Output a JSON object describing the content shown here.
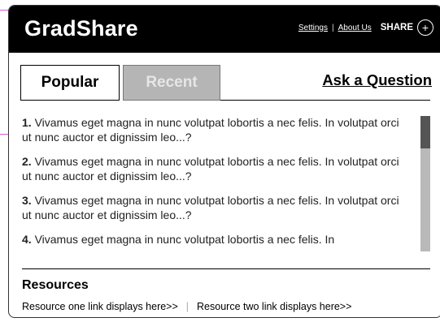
{
  "header": {
    "logo": "GradShare",
    "settings_link": "Settings",
    "link_separator": "|",
    "about_link": "About Us",
    "share_label": "SHARE",
    "share_button": "+"
  },
  "tabs": [
    {
      "label": "Popular",
      "active": true
    },
    {
      "label": "Recent",
      "active": false
    }
  ],
  "ask_link": "Ask a Question",
  "questions": [
    {
      "number": "1.",
      "text": "Vivamus eget magna in nunc volutpat lobortis a nec felis. In volutpat orci ut nunc auctor et dignissim leo...?"
    },
    {
      "number": "2.",
      "text": "Vivamus eget magna in nunc volutpat lobortis a nec felis. In volutpat orci ut nunc auctor et dignissim leo...?"
    },
    {
      "number": "3.",
      "text": "Vivamus eget magna in nunc volutpat lobortis a nec felis. In volutpat orci ut nunc auctor et dignissim leo...?"
    },
    {
      "number": "4.",
      "text": "Vivamus eget magna in nunc volutpat lobortis a nec felis. In"
    }
  ],
  "resources": {
    "heading": "Resources",
    "link_one": "Resource one link displays here>>",
    "separator": "|",
    "link_two": "Resource two link displays here>>"
  },
  "colors": {
    "header_bg": "#000000",
    "inactive_tab_bg": "#b5b5b5",
    "scroll_thumb": "#555555",
    "scroll_track": "#b9b9b9"
  }
}
